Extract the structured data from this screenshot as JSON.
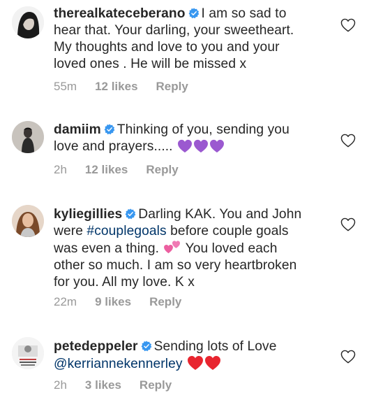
{
  "comments": [
    {
      "username": "therealkateceberano",
      "text_lines": [
        "I am so sad to",
        "hear that. Your darling, your sweetheart.",
        "My thoughts and love to you and your",
        "loved ones . He will be missed x"
      ],
      "time": "55m",
      "likes": "12 likes",
      "reply": "Reply"
    },
    {
      "username": "damiim",
      "text_lines": [
        "Thinking of you, sending you",
        "love and prayers....."
      ],
      "emoji": [
        "purple-heart",
        "purple-heart",
        "purple-heart"
      ],
      "time": "2h",
      "likes": "12 likes",
      "reply": "Reply"
    },
    {
      "username": "kyliegillies",
      "text_a": "Darling  KAK. You and John",
      "text_b1": "were ",
      "hashtag": "#couplegoals",
      "text_b2": " before couple goals",
      "text_c": "was even a thing.",
      "emoji": [
        "two-hearts"
      ],
      "text_c2": "You loved each",
      "text_d": "other so much. I am so very heartbroken",
      "text_e": "for you. All my love. K x",
      "time": "22m",
      "likes": "9 likes",
      "reply": "Reply"
    },
    {
      "username": "petedeppeler",
      "text_a": "Sending lots of Love",
      "mention": "@kerriannekennerley",
      "emoji": [
        "red-heart",
        "red-heart"
      ],
      "time": "2h",
      "likes": "3 likes",
      "reply": "Reply"
    }
  ],
  "colors": {
    "text": "#262626",
    "meta": "#999999",
    "link": "#003569",
    "verified": "#3897f0",
    "purple_heart": "#9b59d0",
    "red_heart": "#e8252f"
  }
}
